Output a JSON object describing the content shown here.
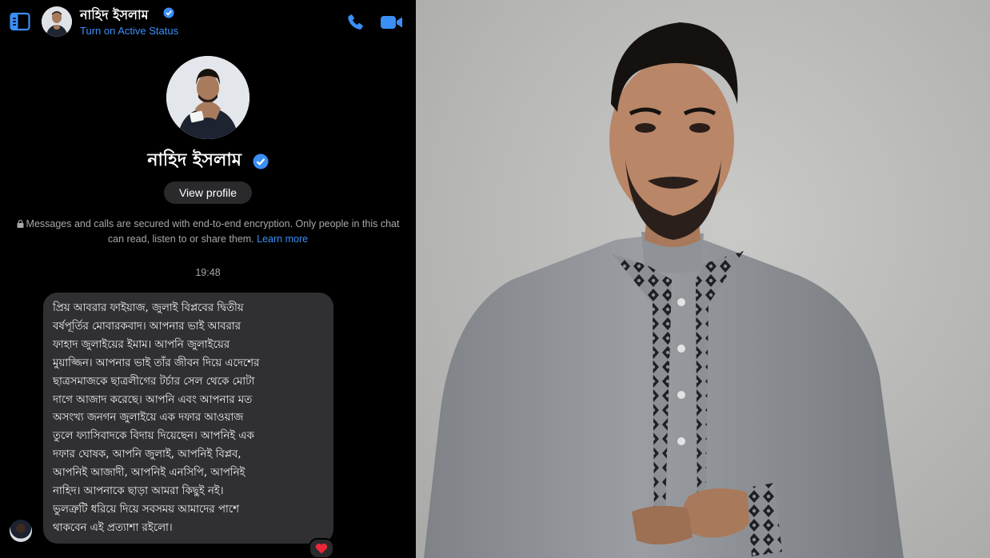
{
  "header": {
    "name": "নাহিদ ইসলাম",
    "status": "Turn on Active Status"
  },
  "profile": {
    "name": "নাহিদ ইসলাম",
    "view_profile_label": "View profile"
  },
  "encryption": {
    "text": "Messages and calls are secured with end-to-end encryption. Only people in this chat can read, listen to or share them.",
    "link": "Learn more"
  },
  "timestamp": "19:48",
  "message": {
    "lines": [
      "প্রিয় আবরার ফাইয়াজ, জুলাই বিপ্লবের দ্বিতীয়",
      "বর্ষপূর্তির মোবারকবাদ। আপনার ভাই আবরার",
      "ফাহাদ জুলাইয়ের ইমাম। আপনি জুলাইয়ের",
      "মুয়াজ্জিন। আপনার ভাই তাঁর জীবন দিয়ে এদেশের",
      "ছাত্রসমাজকে ছাত্রলীগের টর্চার সেল থেকে মোটা",
      "দাগে আজাদ করেছে। আপনি এবং আপনার মত",
      "অসংখ্য জনগন জুলাইয়ে এক দফার আওয়াজ",
      "তুলে ফ্যাসিবাদকে বিদায় দিয়েছেন। আপনিই এক",
      "দফার ঘোষক, আপনি জুলাই, আপনিই বিপ্লব,",
      "আপনিই আজাদী, আপনিই এনসিপি, আপনিই",
      "নাহিদ। আপনাকে ছাড়া আমরা কিছুই নই।",
      "ভুলত্রুটি ধরিয়ে দিয়ে সবসময় আমাদের পাশে",
      "থাকবেন এই প্রত্যাশা রইলো।"
    ],
    "reaction": "heart-icon"
  },
  "colors": {
    "accent": "#3b8ff5",
    "bubble": "#303033",
    "background": "#000000",
    "photo_background": "#c4c4c2",
    "kurta": "#8e9296",
    "embroidery": "#1d1f22"
  }
}
